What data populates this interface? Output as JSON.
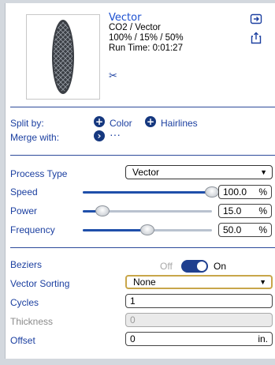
{
  "header": {
    "title": "Vector",
    "line1": "CO2 / Vector",
    "line2": "100% / 15% / 50%",
    "line3": "Run Time: 0:01:27",
    "icons": [
      "scissors-icon",
      "import-icon",
      "export-icon"
    ]
  },
  "split": {
    "label": "Split by:",
    "color_label": "Color",
    "hairlines_label": "Hairlines"
  },
  "merge": {
    "label": "Merge with:",
    "more": "···"
  },
  "process": {
    "label": "Process Type",
    "value": "Vector"
  },
  "sliders": [
    {
      "label": "Speed",
      "value": "100.0",
      "unit": "%",
      "level": 1.0
    },
    {
      "label": "Power",
      "value": "15.0",
      "unit": "%",
      "level": 0.15
    },
    {
      "label": "Frequency",
      "value": "50.0",
      "unit": "%",
      "level": 0.5
    }
  ],
  "beziers": {
    "label": "Beziers",
    "off": "Off",
    "on": "On",
    "state": "on"
  },
  "vector_sorting": {
    "label": "Vector Sorting",
    "value": "None"
  },
  "cycles": {
    "label": "Cycles",
    "value": "1"
  },
  "thickness": {
    "label": "Thickness",
    "value": "0"
  },
  "offset": {
    "label": "Offset",
    "value": "0",
    "unit": "in."
  },
  "colors": {
    "accent": "#1b3fa0",
    "knob": "#d0d4d9",
    "track_fill": "#1f4faa"
  }
}
